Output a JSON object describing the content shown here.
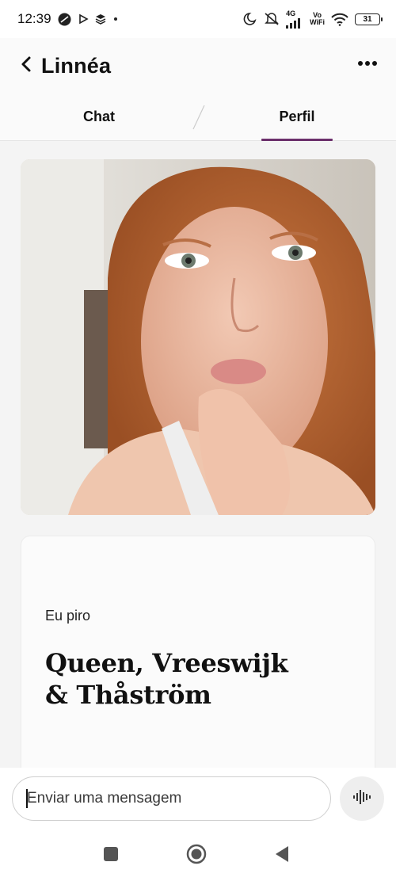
{
  "status_bar": {
    "time": "12:39",
    "network": "4G",
    "vowifi_top": "Vo",
    "vowifi_bottom": "WiFi",
    "battery": "31",
    "icons": [
      "dnd-circle-icon",
      "play-store-icon",
      "layers-icon",
      "dot-icon",
      "moon-icon",
      "mute-icon",
      "signal-icon",
      "wifi-icon",
      "battery-icon"
    ]
  },
  "header": {
    "title": "Linnéa",
    "back_icon": "chevron-left-icon",
    "more_icon": "more-horizontal-icon"
  },
  "tabs": [
    {
      "label": "Chat",
      "active": false
    },
    {
      "label": "Perfil",
      "active": true
    }
  ],
  "colors": {
    "accent": "#6b2f6b",
    "background": "#f4f4f4",
    "card": "#fbfbfb"
  },
  "profile": {
    "prompt": {
      "label": "Eu piro",
      "answer_line1": "Queen, Vreeswijk",
      "answer_line2": "& Thåström"
    }
  },
  "composer": {
    "placeholder": "Enviar uma mensagem",
    "voice_icon": "voice-wave-icon"
  },
  "nav": {
    "icons": [
      "square-recents-icon",
      "circle-home-icon",
      "triangle-back-icon"
    ]
  }
}
